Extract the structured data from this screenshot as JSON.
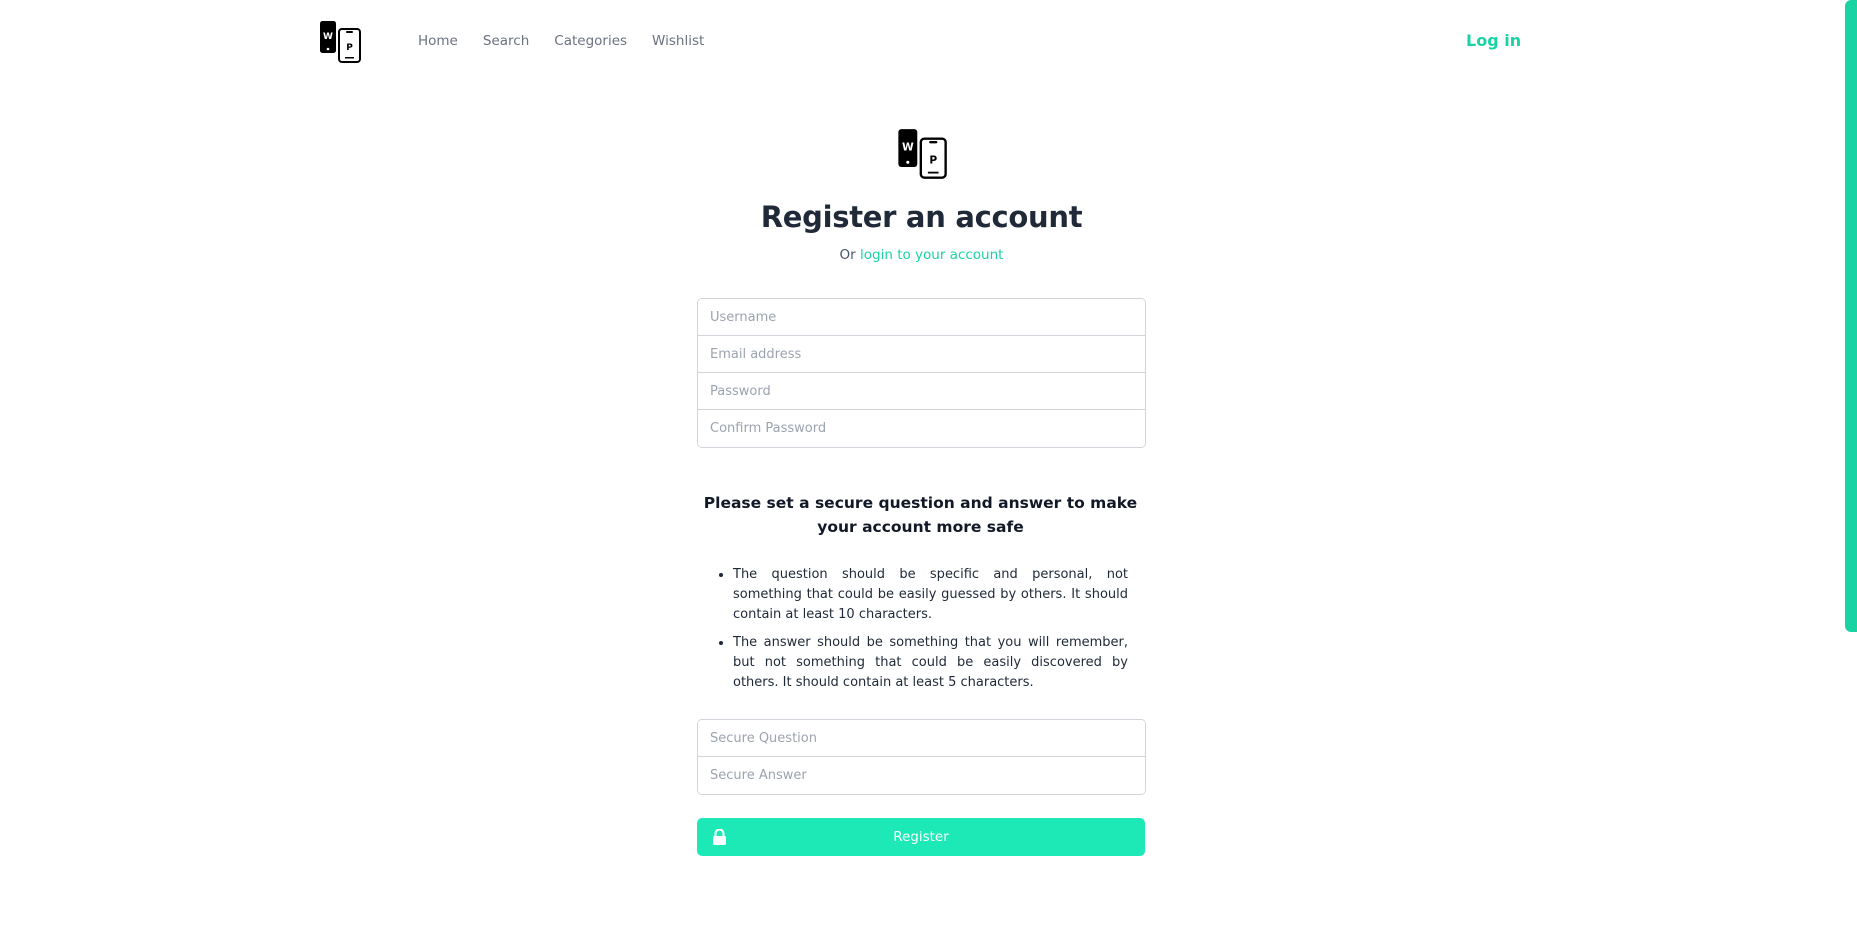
{
  "nav": {
    "logo_icon": "phone-logo-icon",
    "links": [
      "Home",
      "Search",
      "Categories",
      "Wishlist"
    ],
    "login": "Log in"
  },
  "page": {
    "title": "Register an account",
    "subtitle_prefix": "Or",
    "subtitle_link": "login to your account"
  },
  "form": {
    "username_placeholder": "Username",
    "email_placeholder": "Email address",
    "password_placeholder": "Password",
    "confirm_placeholder": "Confirm Password",
    "notice": "Please set a secure question and answer to make your account more safe",
    "rules": [
      "The question should be specific and personal, not something that could be easily guessed by others. It should contain at least 10 characters.",
      "The answer should be something that you will remember, but not something that could be easily discovered by others. It should contain at least 5 characters."
    ],
    "question_placeholder": "Secure Question",
    "answer_placeholder": "Secure Answer",
    "register_label": "Register",
    "register_icon": "lock-icon"
  },
  "colors": {
    "accent": "#19d3a5",
    "button": "#1de9b6",
    "text": "#1f2937",
    "muted": "#6b7280"
  }
}
